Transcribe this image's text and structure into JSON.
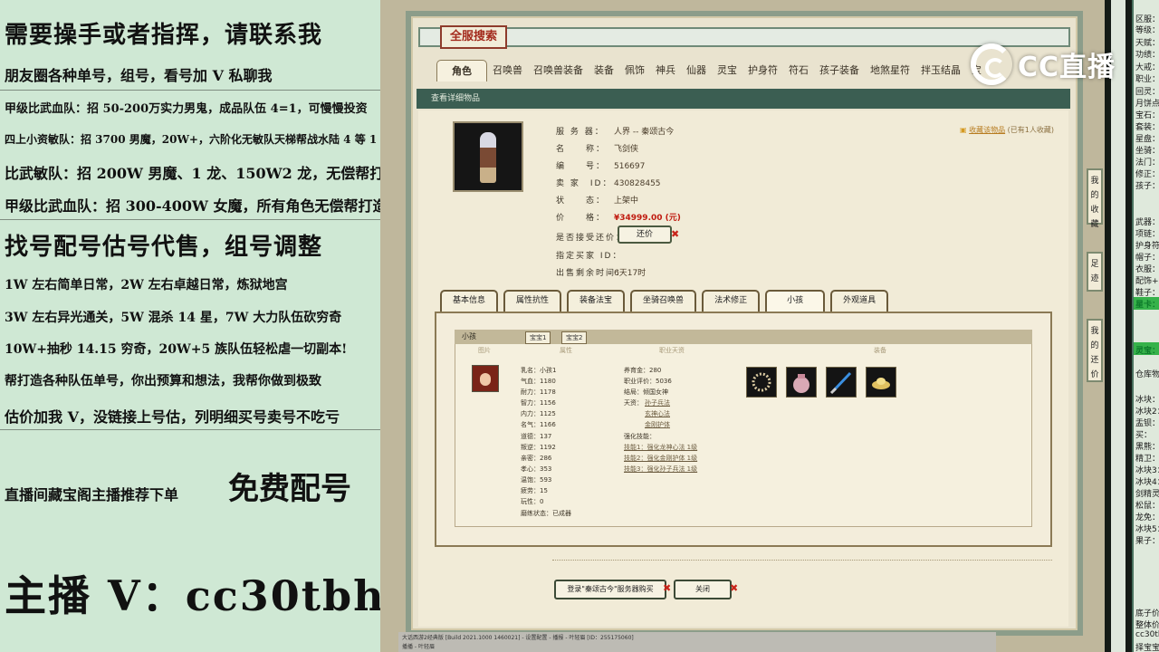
{
  "left_panel": {
    "lines": [
      "需要操手或者指挥，请联系我",
      "朋友圈各种单号，组号，看号加 V 私聊我",
      "甲级比武血队：招 50-200万实力男鬼，成品队伍 4=1，可慢慢投资",
      "四上小资敏队：招 3700 男魔，20W+，六阶化无敏队天梯帮战水陆 4 等 1",
      "比武敏队：招 200W 男魔、1 龙、150W2 龙，无偿帮打造",
      "甲级比武血队：招 300-400W 女魔，所有角色无偿帮打造",
      "找号配号估号代售，组号调整",
      "1W 左右简单日常，2W 左右卓越日常，炼狱地宫",
      "3W 左右异光通关，5W 混杀 14 星，7W 大力队伍砍穷奇",
      "10W+抽秒 14.15 穷奇，20W+5 族队伍轻松虐一切副本!",
      "帮打造各种队伍单号，你出预算和想法，我帮你做到极致",
      "估价加我 V，没链接上号估，列明细买号卖号不吃亏",
      "直播间藏宝阁主播推荐下单",
      "免费配号",
      "主播 V：cc30tbh"
    ]
  },
  "game": {
    "title_badge": "全服搜索",
    "tabs": [
      "角色",
      "召唤兽",
      "召唤兽装备",
      "装备",
      "佩饰",
      "神兵",
      "仙器",
      "灵宝",
      "护身符",
      "符石",
      "孩子装备",
      "地煞星符",
      "拌玉结晶",
      "宝"
    ],
    "section_title": "查看详细物品",
    "favorite_link": "收藏该物品",
    "favorite_count": "(已有1人收藏)",
    "info": [
      {
        "label": "服 务 器：",
        "value": "人界 -- 秦颂古今"
      },
      {
        "label": "名　　称：",
        "value": "飞剑侠"
      },
      {
        "label": "编　　号：",
        "value": "516697"
      },
      {
        "label": "卖 家　ID：",
        "value": "430828455"
      },
      {
        "label": "状　　态：",
        "value": "上架中"
      },
      {
        "label": "价　　格：",
        "value": "¥34999.00 (元)"
      },
      {
        "label": "是否接受还价：",
        "value": ""
      },
      {
        "label": "指定买家 ID：",
        "value": ""
      },
      {
        "label": "出售剩余时间：",
        "value": "6天17时"
      }
    ],
    "haggle_button": "还价",
    "subtabs": [
      "基本信息",
      "属性抗性",
      "装备法宝",
      "坐骑召唤兽",
      "法术修正",
      "小孩",
      "外观道具"
    ],
    "child_section": {
      "title": "小孩",
      "mini_tabs": [
        "宝宝1",
        "宝宝2"
      ],
      "col_heads": [
        "图片",
        "属性",
        "职业天资",
        "装备"
      ],
      "stats": [
        "乳名：小孩1",
        "气血：1180",
        "耐力：1178",
        "智力：1156",
        "内力：1125",
        "名气：1166",
        "道德：137",
        "叛逆：1192",
        "亲密：286",
        "孝心：353",
        "温饱：593",
        "疲劳：15",
        "玩性：0",
        "磨练状态：已成器"
      ],
      "prof": [
        "养育金：280",
        "职业评价：5036",
        "结局：倾国女神",
        "天资："
      ],
      "talents": [
        "孙子兵法",
        "玄神心法",
        "金刚护体"
      ],
      "skills_label": "强化技能：",
      "skills": [
        "技能1：强化龙神心法 1级",
        "技能2：强化金刚护体 1级",
        "技能3：强化孙子兵法 1级"
      ]
    },
    "login_button": "登录\"秦颂古今\"服务器购买",
    "close_button": "关闭",
    "side_buttons": [
      "我的收藏",
      "足迹",
      "我的还价"
    ],
    "taskbar": [
      "大话西游2经典版 [Build 2021.1000 1460021] - 设置配置 - 播报 - 叶轻眉 [ID：255175060]",
      "播播 - 叶轻眉"
    ]
  },
  "right_panel": {
    "items": [
      "区服：",
      "等级：",
      "天赋：",
      "功绩：",
      "大戒：",
      "职业：",
      "回灵：",
      "月饼点：",
      "宝石：",
      "套装：",
      "星盘：",
      "坐骑：",
      "法门：",
      "修正：",
      "孩子：",
      "武器：",
      "项链：",
      "护身符：",
      "帽子：",
      "衣服：",
      "配饰+5：",
      "鞋子：",
      "星卡：",
      "灵宝：",
      "仓库物：",
      "冰块：",
      "冰块2：",
      "盂钡：",
      "买：",
      "黑熊：",
      "精卫：",
      "冰块3：",
      "冰块4：",
      "剑精灵：",
      "松鼠：",
      "龙免：",
      "冰块5：",
      "果子：",
      "底子价：",
      "整体价：",
      "cc30tbh",
      "择宝宝："
    ]
  },
  "logo": {
    "text": "CC直播"
  }
}
